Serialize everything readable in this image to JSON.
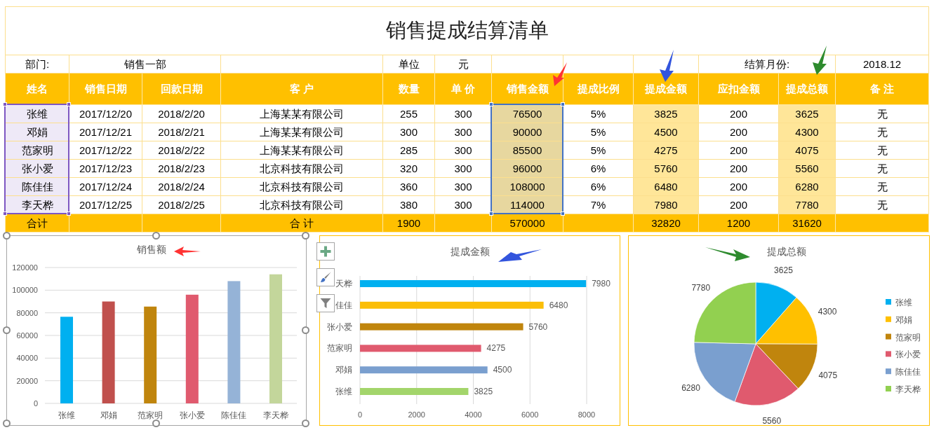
{
  "title": "销售提成结算清单",
  "info": {
    "department_label": "部门:",
    "department": "销售一部",
    "unit_label": "单位",
    "unit": "元",
    "month_label": "结算月份:",
    "month": "2018.12"
  },
  "columns": [
    {
      "label": "姓名",
      "selected": true,
      "color": "#7e57c2",
      "shaded": false
    },
    {
      "label": "销售日期",
      "selected": false,
      "shaded": false
    },
    {
      "label": "回款日期",
      "selected": false,
      "shaded": false
    },
    {
      "label": "客 户",
      "selected": false,
      "shaded": false
    },
    {
      "label": "数量",
      "selected": false,
      "shaded": false
    },
    {
      "label": "单 价",
      "selected": false,
      "shaded": false
    },
    {
      "label": "销售金额",
      "selected": true,
      "color": "#4472c4",
      "shaded": true
    },
    {
      "label": "提成比例",
      "selected": false,
      "shaded": false
    },
    {
      "label": "提成金额",
      "selected": false,
      "shaded": true
    },
    {
      "label": "应扣金额",
      "selected": false,
      "shaded": false
    },
    {
      "label": "提成总额",
      "selected": false,
      "shaded": true
    },
    {
      "label": "备 注",
      "selected": false,
      "shaded": false
    }
  ],
  "rows": [
    [
      "张维",
      "2017/12/20",
      "2018/2/20",
      "上海某某有限公司",
      "255",
      "300",
      "76500",
      "5%",
      "3825",
      "200",
      "3625",
      "无"
    ],
    [
      "邓娟",
      "2017/12/21",
      "2018/2/21",
      "上海某某有限公司",
      "300",
      "300",
      "90000",
      "5%",
      "4500",
      "200",
      "4300",
      "无"
    ],
    [
      "范家明",
      "2017/12/22",
      "2018/2/22",
      "上海某某有限公司",
      "285",
      "300",
      "85500",
      "5%",
      "4275",
      "200",
      "4075",
      "无"
    ],
    [
      "张小爱",
      "2017/12/23",
      "2018/2/23",
      "北京科技有限公司",
      "320",
      "300",
      "96000",
      "6%",
      "5760",
      "200",
      "5560",
      "无"
    ],
    [
      "陈佳佳",
      "2017/12/24",
      "2018/2/24",
      "北京科技有限公司",
      "360",
      "300",
      "108000",
      "6%",
      "6480",
      "200",
      "6280",
      "无"
    ],
    [
      "李天桦",
      "2017/12/25",
      "2018/2/25",
      "北京科技有限公司",
      "380",
      "300",
      "114000",
      "7%",
      "7980",
      "200",
      "7780",
      "无"
    ]
  ],
  "total": {
    "label": "合计",
    "customer": "合 计",
    "quantity": "1900",
    "amount": "570000",
    "commission": "32820",
    "deduction": "1200",
    "total": "31620"
  },
  "charts": [
    {
      "selected": true,
      "points": [
        {
          "color": "#00b0f0"
        },
        {
          "color": "#c0504d"
        },
        {
          "color": "#c0850d"
        },
        {
          "color": "#e05a6e"
        },
        {
          "color": "#95b3d7"
        },
        {
          "color": "#c3d69b"
        }
      ],
      "chart_data": {
        "type": "bar",
        "title": "销售额",
        "categories": [
          "张维",
          "邓娟",
          "范家明",
          "张小爱",
          "陈佳佳",
          "李天桦"
        ],
        "series": [
          {
            "values": [
              76500,
              90000,
              85500,
              96000,
              108000,
              114000
            ]
          }
        ],
        "ylim": [
          0,
          120000
        ],
        "yticks": [
          0,
          20000,
          40000,
          60000,
          80000,
          100000,
          120000
        ],
        "grid": true
      }
    },
    {
      "selected": false,
      "points": [
        {
          "color": "#00b0f0"
        },
        {
          "color": "#fbbe07"
        },
        {
          "color": "#c0850d"
        },
        {
          "color": "#e05a6e"
        },
        {
          "color": "#7a9fcf"
        },
        {
          "color": "#a3d56b"
        }
      ],
      "chart_data": {
        "type": "bar",
        "orientation": "horizontal",
        "title": "提成金额",
        "categories": [
          "天桦",
          "佳佳",
          "张小爱",
          "范家明",
          "邓娟",
          "张维"
        ],
        "series": [
          {
            "values": [
              7980,
              6480,
              5760,
              4275,
              4500,
              3825
            ]
          }
        ],
        "xlim": [
          0,
          8000
        ],
        "xticks": [
          0,
          2000,
          4000,
          6000,
          8000
        ],
        "data_labels": true,
        "grid": true
      }
    },
    {
      "selected": false,
      "points": [
        {
          "color": "#00b0f0"
        },
        {
          "color": "#ffc000"
        },
        {
          "color": "#c0850d"
        },
        {
          "color": "#e05a6e"
        },
        {
          "color": "#7a9fcf"
        },
        {
          "color": "#92d050"
        }
      ],
      "chart_data": {
        "type": "pie",
        "title": "提成总额",
        "categories": [
          "张维",
          "邓娟",
          "范家明",
          "张小爱",
          "陈佳佳",
          "李天桦"
        ],
        "series": [
          {
            "values": [
              3625,
              4300,
              4075,
              5560,
              6280,
              7780
            ]
          }
        ],
        "data_labels": true,
        "legend": "right"
      }
    }
  ]
}
